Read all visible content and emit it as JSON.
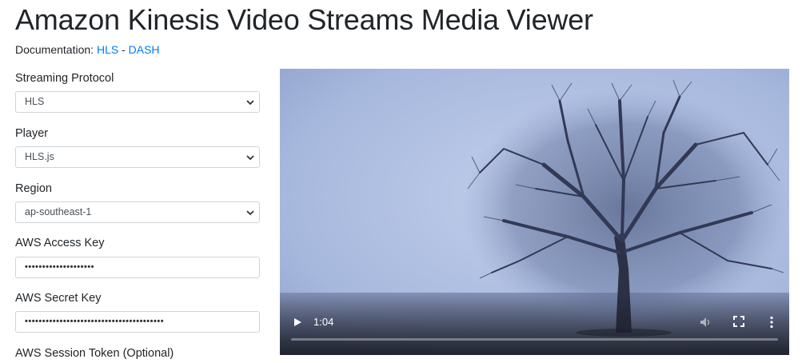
{
  "page": {
    "title": "Amazon Kinesis Video Streams Media Viewer"
  },
  "docs": {
    "label": "Documentation:",
    "links": [
      {
        "label": "HLS"
      },
      {
        "label": "DASH"
      }
    ],
    "separator": " - "
  },
  "form": {
    "streaming_protocol": {
      "label": "Streaming Protocol",
      "value": "HLS"
    },
    "player": {
      "label": "Player",
      "value": "HLS.js"
    },
    "region": {
      "label": "Region",
      "value": "ap-southeast-1"
    },
    "access_key": {
      "label": "AWS Access Key",
      "value": "••••••••••••••••••••"
    },
    "secret_key": {
      "label": "AWS Secret Key",
      "value": "••••••••••••••••••••••••••••••••••••••••"
    },
    "session_token": {
      "label": "AWS Session Token (Optional)"
    }
  },
  "video": {
    "current_time": "1:04",
    "progress_fraction": 0.0,
    "controls": {
      "play_icon": "play-icon",
      "volume_icon": "volume-muted-icon",
      "fullscreen_icon": "fullscreen-icon",
      "more_icon": "more-options-icon"
    }
  },
  "colors": {
    "link": "#007bff",
    "border": "#ced4da",
    "text": "#212529"
  }
}
